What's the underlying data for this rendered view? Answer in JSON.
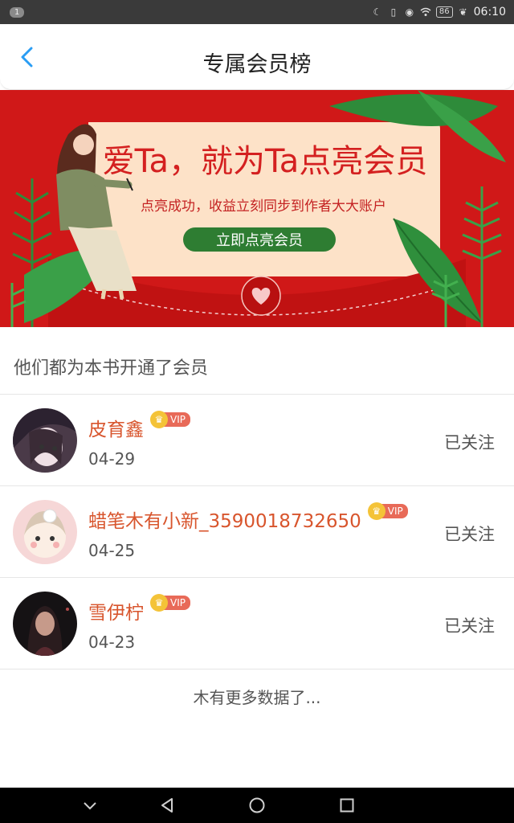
{
  "statusbar": {
    "notification_count": "1",
    "battery": "86",
    "time": "06:10"
  },
  "header": {
    "title": "专属会员榜"
  },
  "banner": {
    "headline": "爱Ta，就为Ta点亮会员",
    "subline": "点亮成功，收益立刻同步到作者大大账户",
    "cta": "立即点亮会员",
    "colors": {
      "background": "#d01818",
      "card": "#fde0c4",
      "cta": "#2e7d32",
      "headline": "#d42020"
    }
  },
  "section": {
    "title": "他们都为本书开通了会员"
  },
  "members": [
    {
      "name": "皮育鑫",
      "badge": "VIP",
      "date": "04-29",
      "action": "已关注"
    },
    {
      "name": "蜡笔木有小新_3590018732650",
      "badge": "VIP",
      "date": "04-25",
      "action": "已关注"
    },
    {
      "name": "雪伊柠",
      "badge": "VIP",
      "date": "04-23",
      "action": "已关注"
    }
  ],
  "footer": {
    "no_more": "木有更多数据了..."
  }
}
